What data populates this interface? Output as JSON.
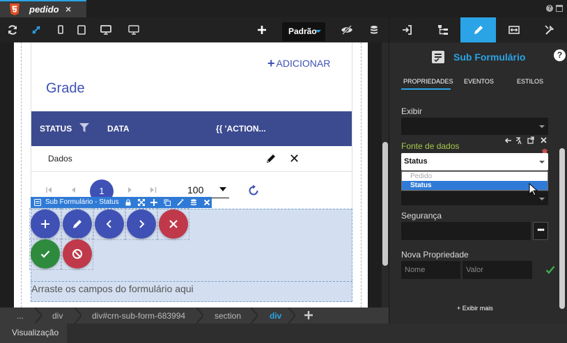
{
  "tabbar": {
    "tab_name": "pedido",
    "close_glyph": "×",
    "help_glyph": "?"
  },
  "toolbar": {
    "icons": [
      "refresh-icon",
      "expand-icon",
      "mobile-icon",
      "tablet-icon",
      "desktop-icon",
      "monitor-icon",
      "add-icon",
      "eye-slash-icon",
      "database-icon"
    ],
    "theme_select": "Padrão"
  },
  "canvas": {
    "add_button": "ADICIONAR",
    "grade_title": "Grade",
    "grid": {
      "columns": [
        "STATUS",
        "DATA",
        "{{ 'ACTION..."
      ],
      "rows": [
        {
          "cell": "Dados"
        }
      ]
    },
    "pager": {
      "current_page": "1",
      "page_size": "100"
    },
    "subform": {
      "label": "Sub Formulário - Status",
      "drop_text": "Arraste os campos do formulário aqui"
    }
  },
  "breadcrumb": {
    "items": [
      "...",
      "div",
      "div#crn-sub-form-683994",
      "section",
      "div"
    ],
    "active_index": 4
  },
  "statusbar": {
    "tab": "Visualização"
  },
  "panel": {
    "title": "Sub Formulário",
    "help_glyph": "?",
    "subtabs": [
      "PROPRIEDADES",
      "EVENTOS",
      "ESTILOS"
    ],
    "fields": {
      "exibir_label": "Exibir",
      "fonte_label": "Fonte de dados",
      "status_value": "Status",
      "options": [
        "Pedido",
        "Status"
      ],
      "seguranca_label": "Segurança",
      "seguranca_button": "•••",
      "nova_label": "Nova Propriedade",
      "nome_placeholder": "Nome",
      "valor_placeholder": "Valor",
      "exibir_mais": "+ Exibir mais"
    }
  },
  "colors": {
    "accent": "#2aa4e6",
    "grid_header": "#3c4a8f",
    "primary": "#3f51b5",
    "danger": "#c0394a",
    "success": "#2e8b3e",
    "data_source_label": "#a5c94a"
  }
}
